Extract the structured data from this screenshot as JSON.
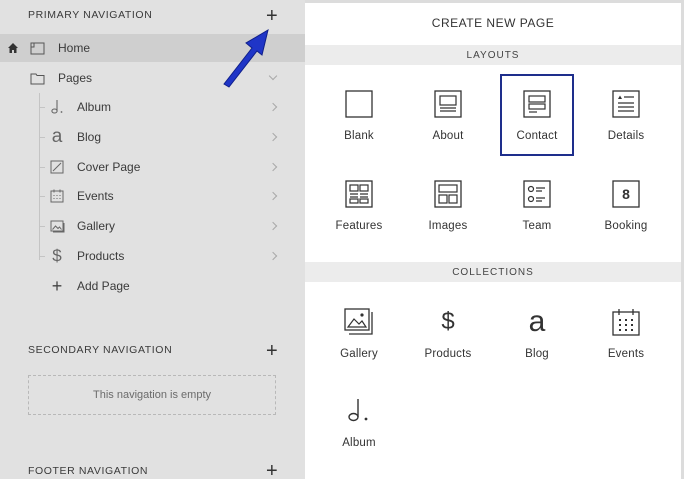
{
  "sidebar": {
    "primary_title": "PRIMARY NAVIGATION",
    "secondary_title": "SECONDARY NAVIGATION",
    "footer_title": "FOOTER NAVIGATION",
    "add_symbol": "+",
    "home": "Home",
    "pages": "Pages",
    "items": [
      {
        "label": "Album",
        "icon": "album-icon"
      },
      {
        "label": "Blog",
        "icon": "blog-icon"
      },
      {
        "label": "Cover Page",
        "icon": "cover-page-icon"
      },
      {
        "label": "Events",
        "icon": "events-icon"
      },
      {
        "label": "Gallery",
        "icon": "gallery-icon"
      },
      {
        "label": "Products",
        "icon": "products-icon"
      }
    ],
    "add_page": "Add Page",
    "secondary_empty": "This navigation is empty"
  },
  "panel": {
    "title": "CREATE NEW PAGE",
    "layouts_title": "LAYOUTS",
    "collections_title": "COLLECTIONS",
    "layouts": [
      "Blank",
      "About",
      "Contact",
      "Details",
      "Features",
      "Images",
      "Team",
      "Booking"
    ],
    "selected_layout": "Contact",
    "booking_glyph": "8",
    "collections": [
      "Gallery",
      "Products",
      "Blog",
      "Events",
      "Album"
    ]
  },
  "colors": {
    "selection_border": "#1e2e8c",
    "arrow": "#1f35c7"
  }
}
